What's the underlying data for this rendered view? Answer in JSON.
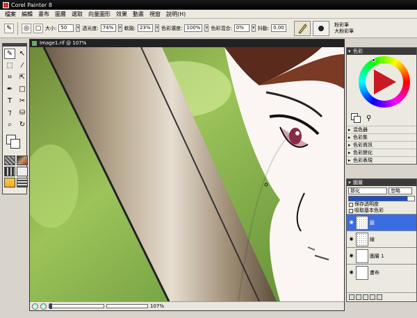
{
  "app": {
    "title": "Corel Painter 8"
  },
  "menu": [
    "檔案",
    "編輯",
    "畫布",
    "圖層",
    "選取",
    "向量圖形",
    "效果",
    "動畫",
    "視窗",
    "說明(H)"
  ],
  "propbar": {
    "size_label": "大小:",
    "size_value": "50",
    "opacity_label": "透光度:",
    "opacity_value": "74%",
    "softness_label": "軟融:",
    "softness_value": "23%",
    "resat_label": "色彩濃度:",
    "resat_value": "100%",
    "bleed_label": "色彩混合:",
    "bleed_value": "0%",
    "jitter_label": "抖動:",
    "jitter_value": "0.00",
    "brush_category": "粉彩筆",
    "brush_variant": "大粉彩筆"
  },
  "document": {
    "title": "Image1.rif @ 107%",
    "zoom": "107%"
  },
  "color_panel": {
    "title": "色彩",
    "sections": [
      "混色器",
      "色彩集",
      "色彩資訊",
      "色彩變化",
      "色彩表現"
    ]
  },
  "layers_panel": {
    "title": "圖層",
    "composite_method": "那化",
    "composite_option": "忽略",
    "preserve_transparency": "保存透明度",
    "pick_up_underlying": "吸取基本色彩",
    "layers": [
      {
        "name": "臉",
        "selected": true
      },
      {
        "name": "線",
        "selected": false
      },
      {
        "name": "圖層 1",
        "selected": false
      },
      {
        "name": "畫布",
        "selected": false
      }
    ]
  },
  "colors": {
    "accent": "#3a6ee0",
    "primary_color": "#c81a22"
  }
}
